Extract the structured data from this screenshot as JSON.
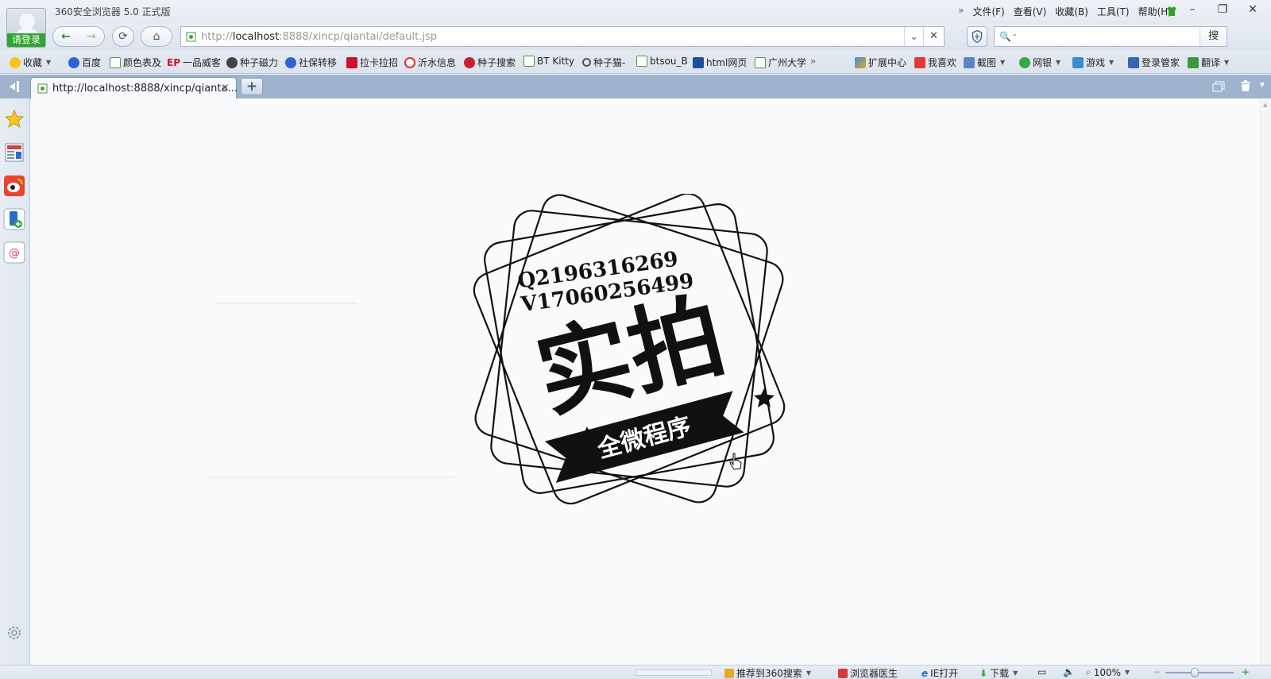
{
  "window": {
    "app_title": "360安全浏览器 5.0 正式版",
    "login_label": "请登录",
    "menu": [
      "文件(F)",
      "查看(V)",
      "收藏(B)",
      "工具(T)",
      "帮助(H)"
    ],
    "menu_more": "»",
    "controls": {
      "minimize": "–",
      "restore": "❐",
      "close": "✕"
    }
  },
  "navbar": {
    "back": "←",
    "forward": "→",
    "refresh": "⟳",
    "home": "⌂",
    "url_prefix": "http://",
    "url_host": "localhost",
    "url_rest": ":8888/xincp/qiantai/default.jsp",
    "addr_dropdown": "⌄",
    "addr_stop": "✕",
    "search_value": "",
    "search_caret": "⌄",
    "search_button": "搜"
  },
  "favorites": {
    "collect_label": "收藏",
    "items": [
      "百度",
      "颜色表及",
      "一品威客",
      "种子磁力",
      "社保转移",
      "拉卡拉招",
      "沂水信息",
      "种子搜索",
      "BT Kitty",
      "种子猫-",
      "btsou_B",
      "html网页",
      "广州大学"
    ],
    "more": "»",
    "tools": [
      "扩展中心",
      "我喜欢",
      "截图",
      "网银",
      "游戏",
      "登录管家",
      "翻译"
    ],
    "badges": {
      "ep": "EP"
    }
  },
  "tabs": {
    "active_title": "http://localhost:8888/xincp/qianta...",
    "close": "×",
    "new_tab": "+"
  },
  "logo": {
    "qq_line": "Q2196316269",
    "wechat_line": "V17060256499",
    "main_text": "实拍",
    "banner_text": "全微程序"
  },
  "statusbar": {
    "items": [
      "推荐到360搜索",
      "浏览器医生",
      "IE打开",
      "下载"
    ],
    "zoom": "100%",
    "zoom_minus": "−",
    "zoom_plus": "+",
    "zoom_level": 0.43
  },
  "colors": {
    "login_green": "#2ea62e",
    "tab_bar": "#9db3ce",
    "content_bg": "#f9fafb"
  }
}
